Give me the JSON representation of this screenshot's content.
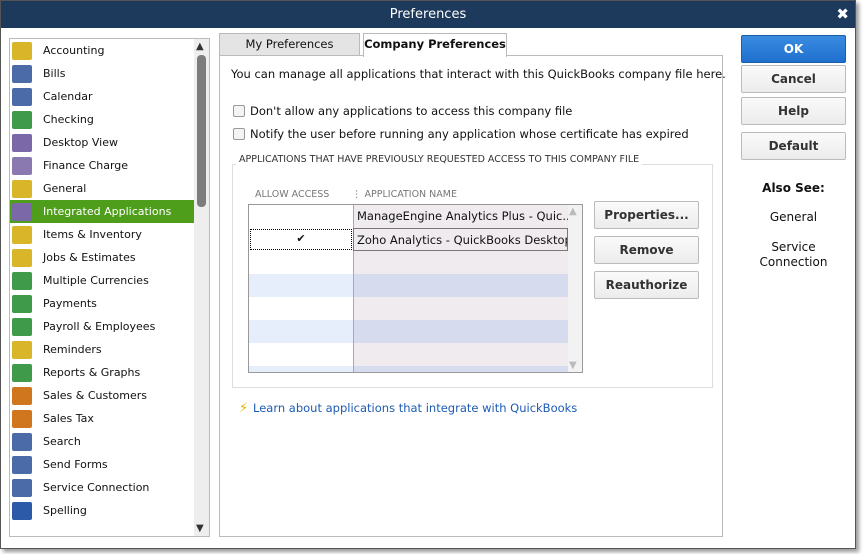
{
  "window": {
    "title": "Preferences"
  },
  "sidebar": {
    "items": [
      {
        "label": "Accounting",
        "color": "#d9b52a"
      },
      {
        "label": "Bills",
        "color": "#4a6aa8"
      },
      {
        "label": "Calendar",
        "color": "#4a6aa8"
      },
      {
        "label": "Checking",
        "color": "#3f9a4a"
      },
      {
        "label": "Desktop View",
        "color": "#7b68a8"
      },
      {
        "label": "Finance Charge",
        "color": "#8a78b0"
      },
      {
        "label": "General",
        "color": "#d9b52a"
      },
      {
        "label": "Integrated Applications",
        "color": "#7b68a8"
      },
      {
        "label": "Items & Inventory",
        "color": "#d9b52a"
      },
      {
        "label": "Jobs & Estimates",
        "color": "#d9b52a"
      },
      {
        "label": "Multiple Currencies",
        "color": "#3f9a4a"
      },
      {
        "label": "Payments",
        "color": "#3f9a4a"
      },
      {
        "label": "Payroll & Employees",
        "color": "#3f9a4a"
      },
      {
        "label": "Reminders",
        "color": "#d9b52a"
      },
      {
        "label": "Reports & Graphs",
        "color": "#3f9a4a"
      },
      {
        "label": "Sales & Customers",
        "color": "#d0761f"
      },
      {
        "label": "Sales Tax",
        "color": "#d0761f"
      },
      {
        "label": "Search",
        "color": "#4a6aa8"
      },
      {
        "label": "Send Forms",
        "color": "#4a6aa8"
      },
      {
        "label": "Service Connection",
        "color": "#4a6aa8"
      },
      {
        "label": "Spelling",
        "color": "#2d5aa8"
      }
    ],
    "selected": "Integrated Applications"
  },
  "tabs": {
    "my": "My Preferences",
    "company": "Company Preferences"
  },
  "main": {
    "intro": "You can manage all applications that interact with this QuickBooks company file here.",
    "opt1": "Don't allow any applications to access this company file",
    "opt2": "Notify the user before running any application whose certificate has expired",
    "group_label": "APPLICATIONS THAT HAVE PREVIOUSLY REQUESTED ACCESS TO THIS COMPANY FILE",
    "col_allow": "ALLOW ACCESS",
    "col_name": "APPLICATION NAME",
    "rows": [
      {
        "allow": "",
        "name": "ManageEngine Analytics Plus - Quic..."
      },
      {
        "allow": "✔",
        "name": "Zoho Analytics - QuickBooks Desktop"
      }
    ],
    "properties": "Properties...",
    "remove": "Remove",
    "reauthorize": "Reauthorize",
    "learn": "Learn about applications that integrate with QuickBooks"
  },
  "right": {
    "ok": "OK",
    "cancel": "Cancel",
    "help": "Help",
    "default": "Default",
    "also_see": "Also See:",
    "general": "General",
    "service1": "Service",
    "service2": "Connection"
  }
}
